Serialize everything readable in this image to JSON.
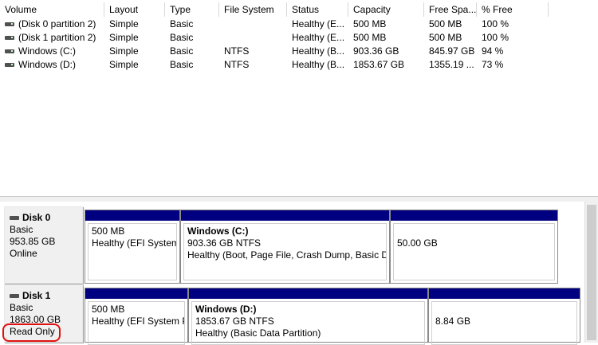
{
  "volumes": {
    "columns": [
      "Volume",
      "Layout",
      "Type",
      "File System",
      "Status",
      "Capacity",
      "Free Spa...",
      "% Free"
    ],
    "rows": [
      [
        "(Disk 0 partition 2)",
        "Simple",
        "Basic",
        "",
        "Healthy (E...",
        "500 MB",
        "500 MB",
        "100 %"
      ],
      [
        "(Disk 1 partition 2)",
        "Simple",
        "Basic",
        "",
        "Healthy (E...",
        "500 MB",
        "500 MB",
        "100 %"
      ],
      [
        "Windows (C:)",
        "Simple",
        "Basic",
        "NTFS",
        "Healthy (B...",
        "903.36 GB",
        "845.97 GB",
        "94 %"
      ],
      [
        "Windows (D:)",
        "Simple",
        "Basic",
        "NTFS",
        "Healthy (B...",
        "1853.67 GB",
        "1355.19 ...",
        "73 %"
      ]
    ]
  },
  "disks": [
    {
      "name": "Disk 0",
      "type": "Basic",
      "size": "953.85 GB",
      "state": "Online",
      "partitions": [
        {
          "title": "",
          "size": "500 MB",
          "status": "Healthy (EFI System"
        },
        {
          "title": "Windows  (C:)",
          "size": "903.36 GB NTFS",
          "status": "Healthy (Boot, Page File, Crash Dump, Basic Da"
        },
        {
          "title": "",
          "size": "50.00 GB",
          "status": ""
        }
      ]
    },
    {
      "name": "Disk 1",
      "type": "Basic",
      "size": "1863.00 GB",
      "state": "Read Only",
      "partitions": [
        {
          "title": "",
          "size": "500 MB",
          "status": "Healthy (EFI System P"
        },
        {
          "title": "Windows  (D:)",
          "size": "1853.67 GB NTFS",
          "status": "Healthy (Basic Data Partition)"
        },
        {
          "title": "",
          "size": "8.84 GB",
          "status": ""
        }
      ]
    }
  ],
  "colors": {
    "partition_bar": "#000080",
    "highlight": "#e01010"
  }
}
